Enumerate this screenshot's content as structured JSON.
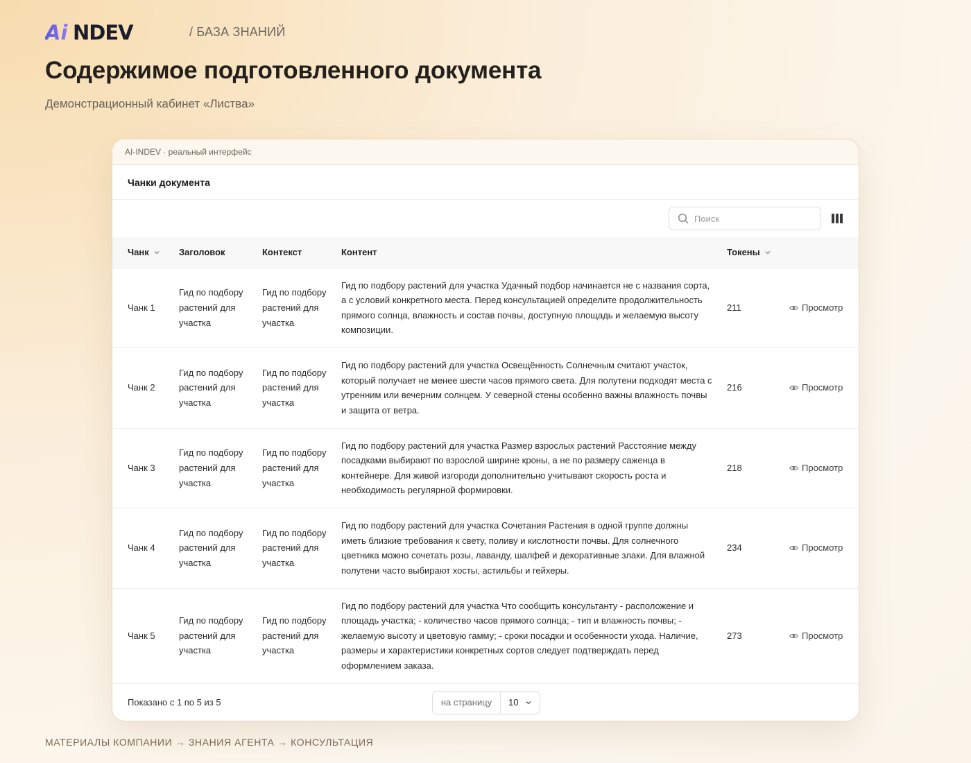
{
  "brand": {
    "logo_text": "AiNDEV",
    "logo_gradient": [
      "#5b57e8",
      "#8f7cf0"
    ],
    "logo_color": "#1d1d2a",
    "section": "/ БАЗА ЗНАНИЙ"
  },
  "page": {
    "title": "Содержимое подготовленного документа",
    "subtitle": "Демонстрационный кабинет «Листва»"
  },
  "frame": {
    "label": "AI-INDEV · реальный интерфейс"
  },
  "card": {
    "title": "Чанки документа"
  },
  "search": {
    "placeholder": "Поиск",
    "value": "",
    "icon": "search-icon"
  },
  "toolbar": {
    "columns_icon": "columns-icon"
  },
  "table": {
    "columns": [
      "Чанк",
      "Заголовок",
      "Контекст",
      "Контент",
      "Токены"
    ],
    "sortable": [
      "Чанк",
      "Токены"
    ],
    "rows": [
      {
        "chunk": "Чанк 1",
        "title": "Гид по подбору растений для участка",
        "context": "Гид по подбору растений для участка",
        "content": "Гид по подбору растений для участка Удачный подбор начинается не с названия сорта, а с условий конкретного места. Перед консультацией определите продолжительность прямого солнца, влажность и состав почвы, доступную площадь и желаемую высоту композиции.",
        "tokens": "211",
        "action": "Просмотр"
      },
      {
        "chunk": "Чанк 2",
        "title": "Гид по подбору растений для участка",
        "context": "Гид по подбору растений для участка",
        "content": "Гид по подбору растений для участка Освещённость Солнечным считают участок, который получает не менее шести часов прямого света. Для полутени подходят места с утренним или вечерним солнцем. У северной стены особенно важны влажность почвы и защита от ветра.",
        "tokens": "216",
        "action": "Просмотр"
      },
      {
        "chunk": "Чанк 3",
        "title": "Гид по подбору растений для участка",
        "context": "Гид по подбору растений для участка",
        "content": "Гид по подбору растений для участка Размер взрослых растений Расстояние между посадками выбирают по взрослой ширине кроны, а не по размеру саженца в контейнере. Для живой изгороди дополнительно учитывают скорость роста и необходимость регулярной формировки.",
        "tokens": "218",
        "action": "Просмотр"
      },
      {
        "chunk": "Чанк 4",
        "title": "Гид по подбору растений для участка",
        "context": "Гид по подбору растений для участка",
        "content": "Гид по подбору растений для участка Сочетания Растения в одной группе должны иметь близкие требования к свету, поливу и кислотности почвы. Для солнечного цветника можно сочетать розы, лаванду, шалфей и декоративные злаки. Для влажной полутени часто выбирают хосты, астильбы и гейхеры.",
        "tokens": "234",
        "action": "Просмотр"
      },
      {
        "chunk": "Чанк 5",
        "title": "Гид по подбору растений для участка",
        "context": "Гид по подбору растений для участка",
        "content": "Гид по подбору растений для участка Что сообщить консультанту - расположение и площадь участка; - количество часов прямого солнца; - тип и влажность почвы; - желаемую высоту и цветовую гамму; - сроки посадки и особенности ухода. Наличие, размеры и характеристики конкретных сортов следует подтверждать перед оформлением заказа.",
        "tokens": "273",
        "action": "Просмотр"
      }
    ]
  },
  "pagination": {
    "showing": "Показано с 1 по 5 из 5",
    "per_page_label": "на страницу",
    "per_page_value": "10"
  },
  "caption": "МАТЕРИАЛЫ КОМПАНИИ → ЗНАНИЯ АГЕНТА → КОНСУЛЬТАЦИЯ"
}
